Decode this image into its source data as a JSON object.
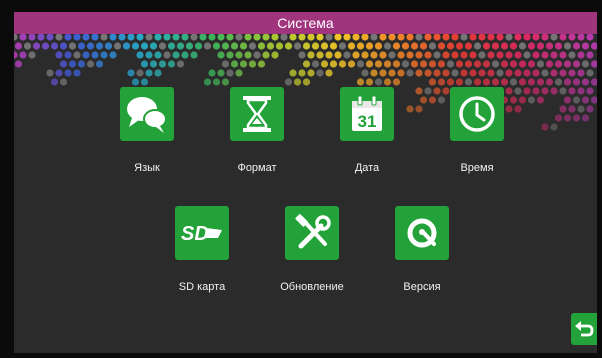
{
  "header": {
    "title": "Система"
  },
  "menu": {
    "items": [
      {
        "label": "Язык",
        "icon": "chat-bubbles-icon"
      },
      {
        "label": "Формат",
        "icon": "hourglass-icon"
      },
      {
        "label": "Дата",
        "icon": "calendar-icon"
      },
      {
        "label": "Время",
        "icon": "clock-icon"
      },
      {
        "label": "SD карта",
        "icon": "sd-card-icon"
      },
      {
        "label": "Обновление",
        "icon": "wrench-hammer-icon"
      },
      {
        "label": "Версия",
        "icon": "version-icon"
      }
    ]
  },
  "footer": {
    "back_icon": "back-arrow-icon"
  },
  "colors": {
    "title_bar": "#a0347d",
    "tile": "#24a23a",
    "background": "#2b2b2b"
  }
}
